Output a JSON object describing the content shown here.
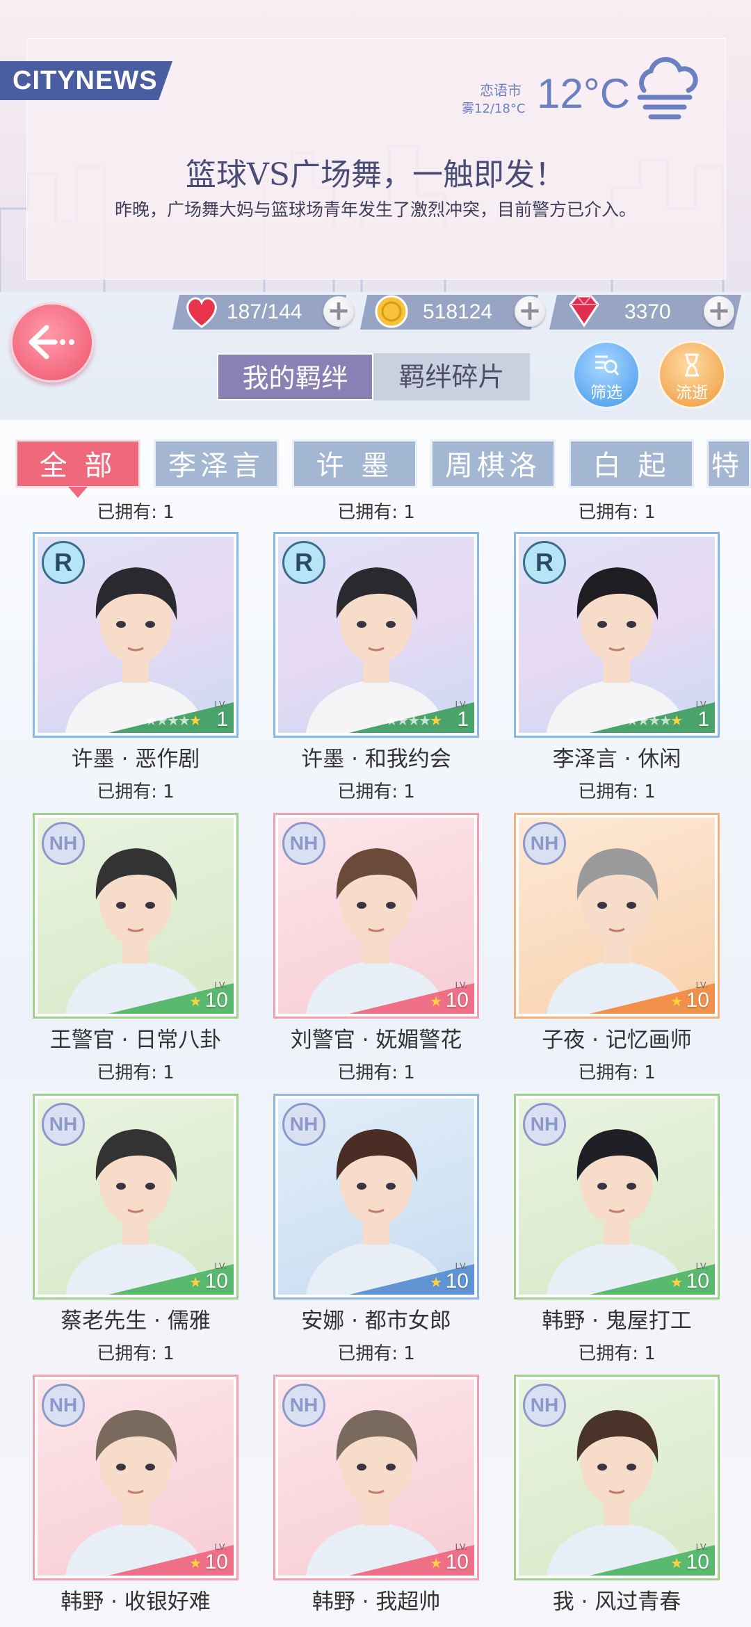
{
  "news": {
    "brand": "CITYNEWS",
    "city": "恋语市",
    "weather": "雾12/18°C",
    "temperature": "12°C",
    "headline": "篮球VS广场舞，一触即发！",
    "summary": "昨晚，广场舞大妈与篮球场青年发生了激烈冲突，目前警方已介入。"
  },
  "currency": {
    "stamina": "187/144",
    "gold": "518124",
    "diamond": "3370"
  },
  "tabs": {
    "active": "我的羁绊",
    "inactive": "羁绊碎片"
  },
  "buttons": {
    "filter": "筛选",
    "flow": "流逝"
  },
  "chips": [
    "全 部",
    "李泽言",
    "许 墨",
    "周棋洛",
    "白 起",
    "特別"
  ],
  "top_owned": [
    "已拥有: 1",
    "已拥有: 1",
    "已拥有: 1"
  ],
  "cards": [
    {
      "name": "许墨 · 恶作剧",
      "owned": "已拥有: 1",
      "rarity": "R",
      "level": "1",
      "theme": "lav"
    },
    {
      "name": "许墨 · 和我约会",
      "owned": "已拥有: 1",
      "rarity": "R",
      "level": "1",
      "theme": "lav"
    },
    {
      "name": "李泽言 · 休闲",
      "owned": "已拥有: 1",
      "rarity": "R",
      "level": "1",
      "theme": "lav"
    },
    {
      "name": "王警官 · 日常八卦",
      "owned": "已拥有: 1",
      "rarity": "NH",
      "level": "10",
      "theme": "green"
    },
    {
      "name": "刘警官 · 妩媚警花",
      "owned": "已拥有: 1",
      "rarity": "NH",
      "level": "10",
      "theme": "pink"
    },
    {
      "name": "子夜 · 记忆画师",
      "owned": "已拥有: 1",
      "rarity": "NH",
      "level": "10",
      "theme": "orange"
    },
    {
      "name": "蔡老先生 · 儒雅",
      "owned": "已拥有: 1",
      "rarity": "NH",
      "level": "10",
      "theme": "green"
    },
    {
      "name": "安娜 · 都市女郎",
      "owned": "已拥有: 1",
      "rarity": "NH",
      "level": "10",
      "theme": "blue"
    },
    {
      "name": "韩野 · 鬼屋打工",
      "owned": "已拥有: 1",
      "rarity": "NH",
      "level": "10",
      "theme": "green"
    },
    {
      "name": "韩野 · 收银好难",
      "owned": "",
      "rarity": "NH",
      "level": "10",
      "theme": "pink"
    },
    {
      "name": "韩野 · 我超帅",
      "owned": "",
      "rarity": "NH",
      "level": "10",
      "theme": "pink"
    },
    {
      "name": "我 · 风过青春",
      "owned": "",
      "rarity": "NH",
      "level": "10",
      "theme": "green"
    }
  ],
  "lv_prefix": "LV.",
  "colors": {
    "accent": "#f0687c",
    "chip": "#a3b7d3",
    "tab_active": "#8b80b3"
  }
}
